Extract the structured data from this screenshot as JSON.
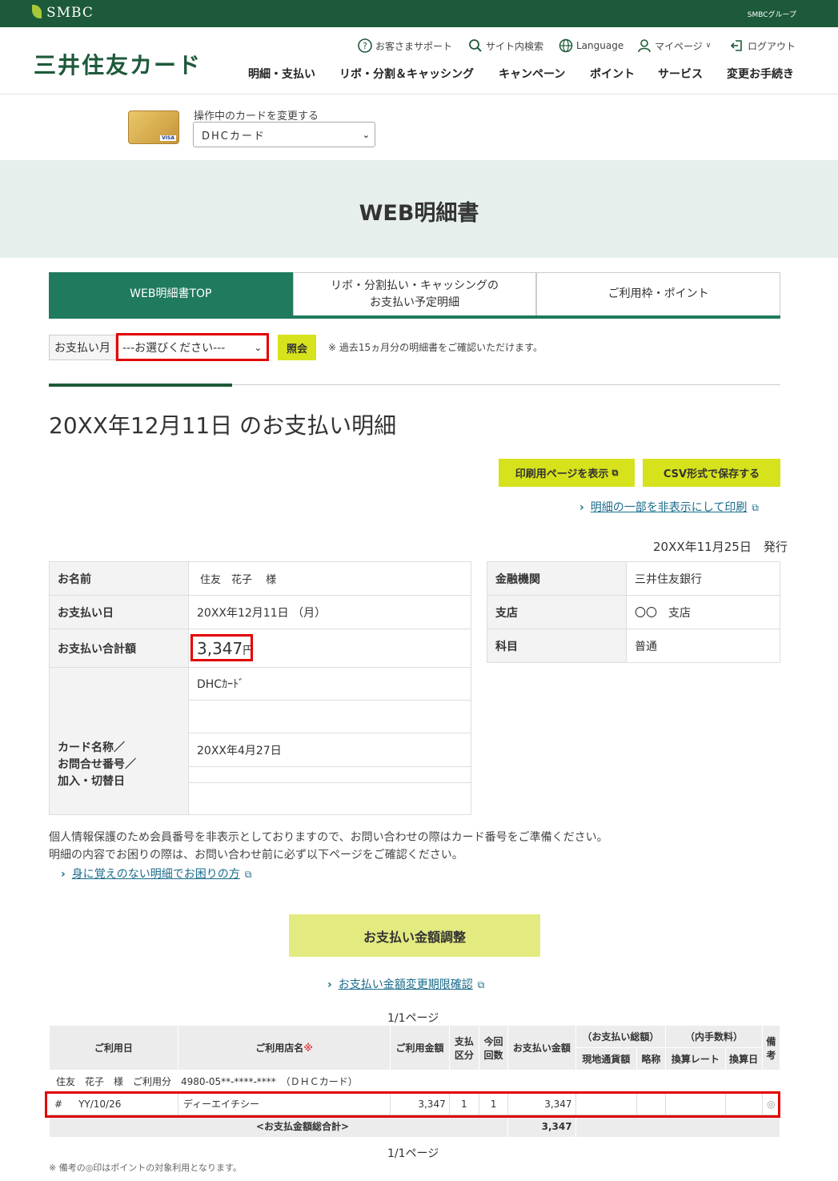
{
  "topbar": {
    "brand": "SMBC",
    "group": "SMBCグループ"
  },
  "header": {
    "logo": "三井住友カード",
    "util": [
      "お客さまサポート",
      "サイト内検索",
      "Language",
      "マイページ",
      "ログアウト"
    ],
    "nav": [
      "明細・支払い",
      "リボ・分割＆キャッシング",
      "キャンペーン",
      "ポイント",
      "サービス",
      "変更お手続き"
    ]
  },
  "card_select": {
    "label": "操作中のカードを変更する",
    "value": "DHCカード",
    "card_brand": "VISA"
  },
  "hero": {
    "title": "WEB明細書"
  },
  "tabs": [
    "WEB明細書TOP",
    "リボ・分割払い・キャッシングの\nお支払い予定明細",
    "ご利用枠・ポイント"
  ],
  "month_filter": {
    "label": "お支払い月",
    "value": "---お選びください---",
    "button": "照会",
    "note": "※ 過去15ヵ月分の明細書をご確認いただけます。"
  },
  "statement": {
    "title": "20XX年12月11日 のお支払い明細",
    "print_button": "印刷用ページを表示",
    "csv_button": "CSV形式で保存する",
    "partial_print_link": "明細の一部を非表示にして印刷",
    "issued": "20XX年11月25日　発行"
  },
  "info_left": {
    "name_label": "お名前",
    "name_value": "住友　花子　 様",
    "date_label": "お支払い日",
    "date_value": "20XX年12月11日 （月）",
    "total_label": "お支払い合計額",
    "total_value": "3,347",
    "total_unit": "円",
    "card_label": "カード名称／\nお問合せ番号／\n加入・切替日",
    "card_name": "DHCｶｰﾄﾞ",
    "card_date": "20XX年4月27日"
  },
  "info_right": {
    "bank_label": "金融機関",
    "bank_value": "三井住友銀行",
    "branch_label": "支店",
    "branch_value": "〇〇　支店",
    "type_label": "科目",
    "type_value": "普通"
  },
  "notes": {
    "line1": "個人情報保護のため会員番号を非表示としておりますので、お問い合わせの際はカード番号をご準備ください。",
    "line2": "明細の内容でお困りの際は、お問い合わせ前に必ず以下ページをご確認ください。",
    "link": "身に覚えのない明細でお困りの方"
  },
  "adjust": {
    "button": "お支払い金額調整",
    "link": "お支払い金額変更期限確認"
  },
  "pager": "1/1ページ",
  "table": {
    "headers": {
      "date": "ご利用日",
      "shop": "ご利用店名",
      "shop_mark": "※",
      "amount": "ご利用金額",
      "kubun": "支払\n区分",
      "kaisuu": "今回\n回数",
      "pay": "お支払い金額",
      "total_group": "（お支払い総額）",
      "fee_group": "（内手数料）",
      "local": "現地通貨額",
      "abbr": "略称",
      "rate": "換算レート",
      "conv_date": "換算日",
      "note": "備\n考"
    },
    "user_row": "住友　花子　様　ご利用分　4980-05**-****-****　（ＤＨＣカード）",
    "rows": [
      {
        "mark": "#",
        "date": "YY/10/26",
        "shop": "ディーエイチシー",
        "amount": "3,347",
        "kubun": "1",
        "kaisuu": "1",
        "pay": "3,347",
        "note": "◎"
      }
    ],
    "total_label": "<お支払金額総合計>",
    "total_value": "3,347"
  },
  "footnote": "※ 備考の◎印はポイントの対象利用となります。"
}
